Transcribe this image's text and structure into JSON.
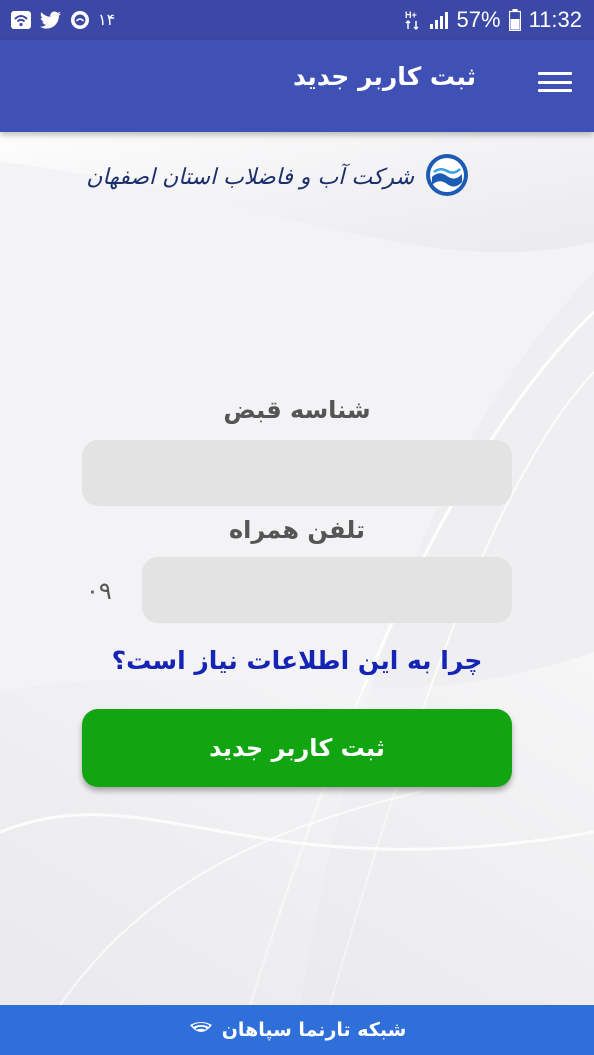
{
  "status_bar": {
    "notification_count": "۱۴",
    "network_label": "H+",
    "battery_percent": "57%",
    "time": "11:32"
  },
  "app_bar": {
    "title": "ثبت کاربر جدید"
  },
  "logo": {
    "text": "شرکت آب و فاضلاب استان اصفهان"
  },
  "form": {
    "bill_id_label": "شناسه قبض",
    "bill_id_value": "",
    "phone_label": "تلفن همراه",
    "phone_prefix": "۰۹",
    "phone_value": "",
    "why_link": "چرا به این اطلاعات نیاز است؟",
    "submit_label": "ثبت کاربر جدید"
  },
  "footer": {
    "text": "شبکه تارنما سپاهان"
  },
  "colors": {
    "status_bar": "#3b48a6",
    "app_bar": "#3f51b5",
    "submit_button": "#12a512",
    "link": "#1524b5",
    "footer": "#2f6fd9"
  }
}
